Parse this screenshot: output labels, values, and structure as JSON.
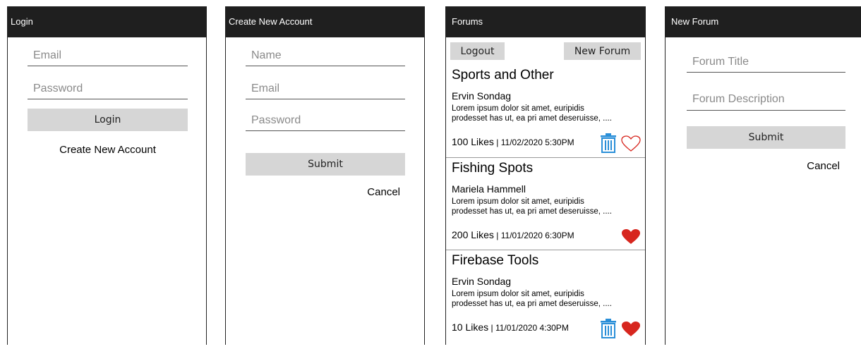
{
  "login": {
    "title": "Login",
    "email_placeholder": "Email",
    "password_placeholder": "Password",
    "login_label": "Login",
    "create_account_link": "Create New Account"
  },
  "create_account": {
    "title": "Create New Account",
    "name_placeholder": "Name",
    "email_placeholder": "Email",
    "password_placeholder": "Password",
    "submit_label": "Submit",
    "cancel_label": "Cancel"
  },
  "forums": {
    "title": "Forums",
    "logout_label": "Logout",
    "new_forum_label": "New Forum",
    "items": [
      {
        "title": "Sports and Other",
        "author": "Ervin Sondag",
        "body_line1": "Lorem ipsum dolor sit amet, euripidis",
        "body_line2": "prodesset has ut, ea pri amet deseruisse, ....",
        "likes": "100 Likes",
        "separator": " | ",
        "date": "11/02/2020 5:30PM",
        "liked": false,
        "deletable": true
      },
      {
        "title": "Fishing Spots",
        "author": "Mariela Hammell",
        "body_line1": "Lorem ipsum dolor sit amet, euripidis",
        "body_line2": "prodesset has ut, ea pri amet deseruisse, ....",
        "likes": "200 Likes",
        "separator": " | ",
        "date": "11/01/2020 6:30PM",
        "liked": true,
        "deletable": false
      },
      {
        "title": "Firebase Tools",
        "author": "Ervin Sondag",
        "body_line1": "Lorem ipsum dolor sit amet, euripidis",
        "body_line2": "prodesset has ut, ea pri amet deseruisse, ....",
        "likes": "10 Likes",
        "separator": " | ",
        "date": "11/01/2020 4:30PM",
        "liked": true,
        "deletable": true
      }
    ]
  },
  "new_forum": {
    "title": "New Forum",
    "title_placeholder": "Forum Title",
    "description_placeholder": "Forum Description",
    "submit_label": "Submit",
    "cancel_label": "Cancel"
  },
  "colors": {
    "titlebar": "#1f1f1f",
    "button": "#d6d6d6",
    "heart": "#d7261e",
    "trash": "#2a8fd8"
  },
  "icons": {
    "delete": "trash-icon",
    "like": "heart-icon"
  }
}
